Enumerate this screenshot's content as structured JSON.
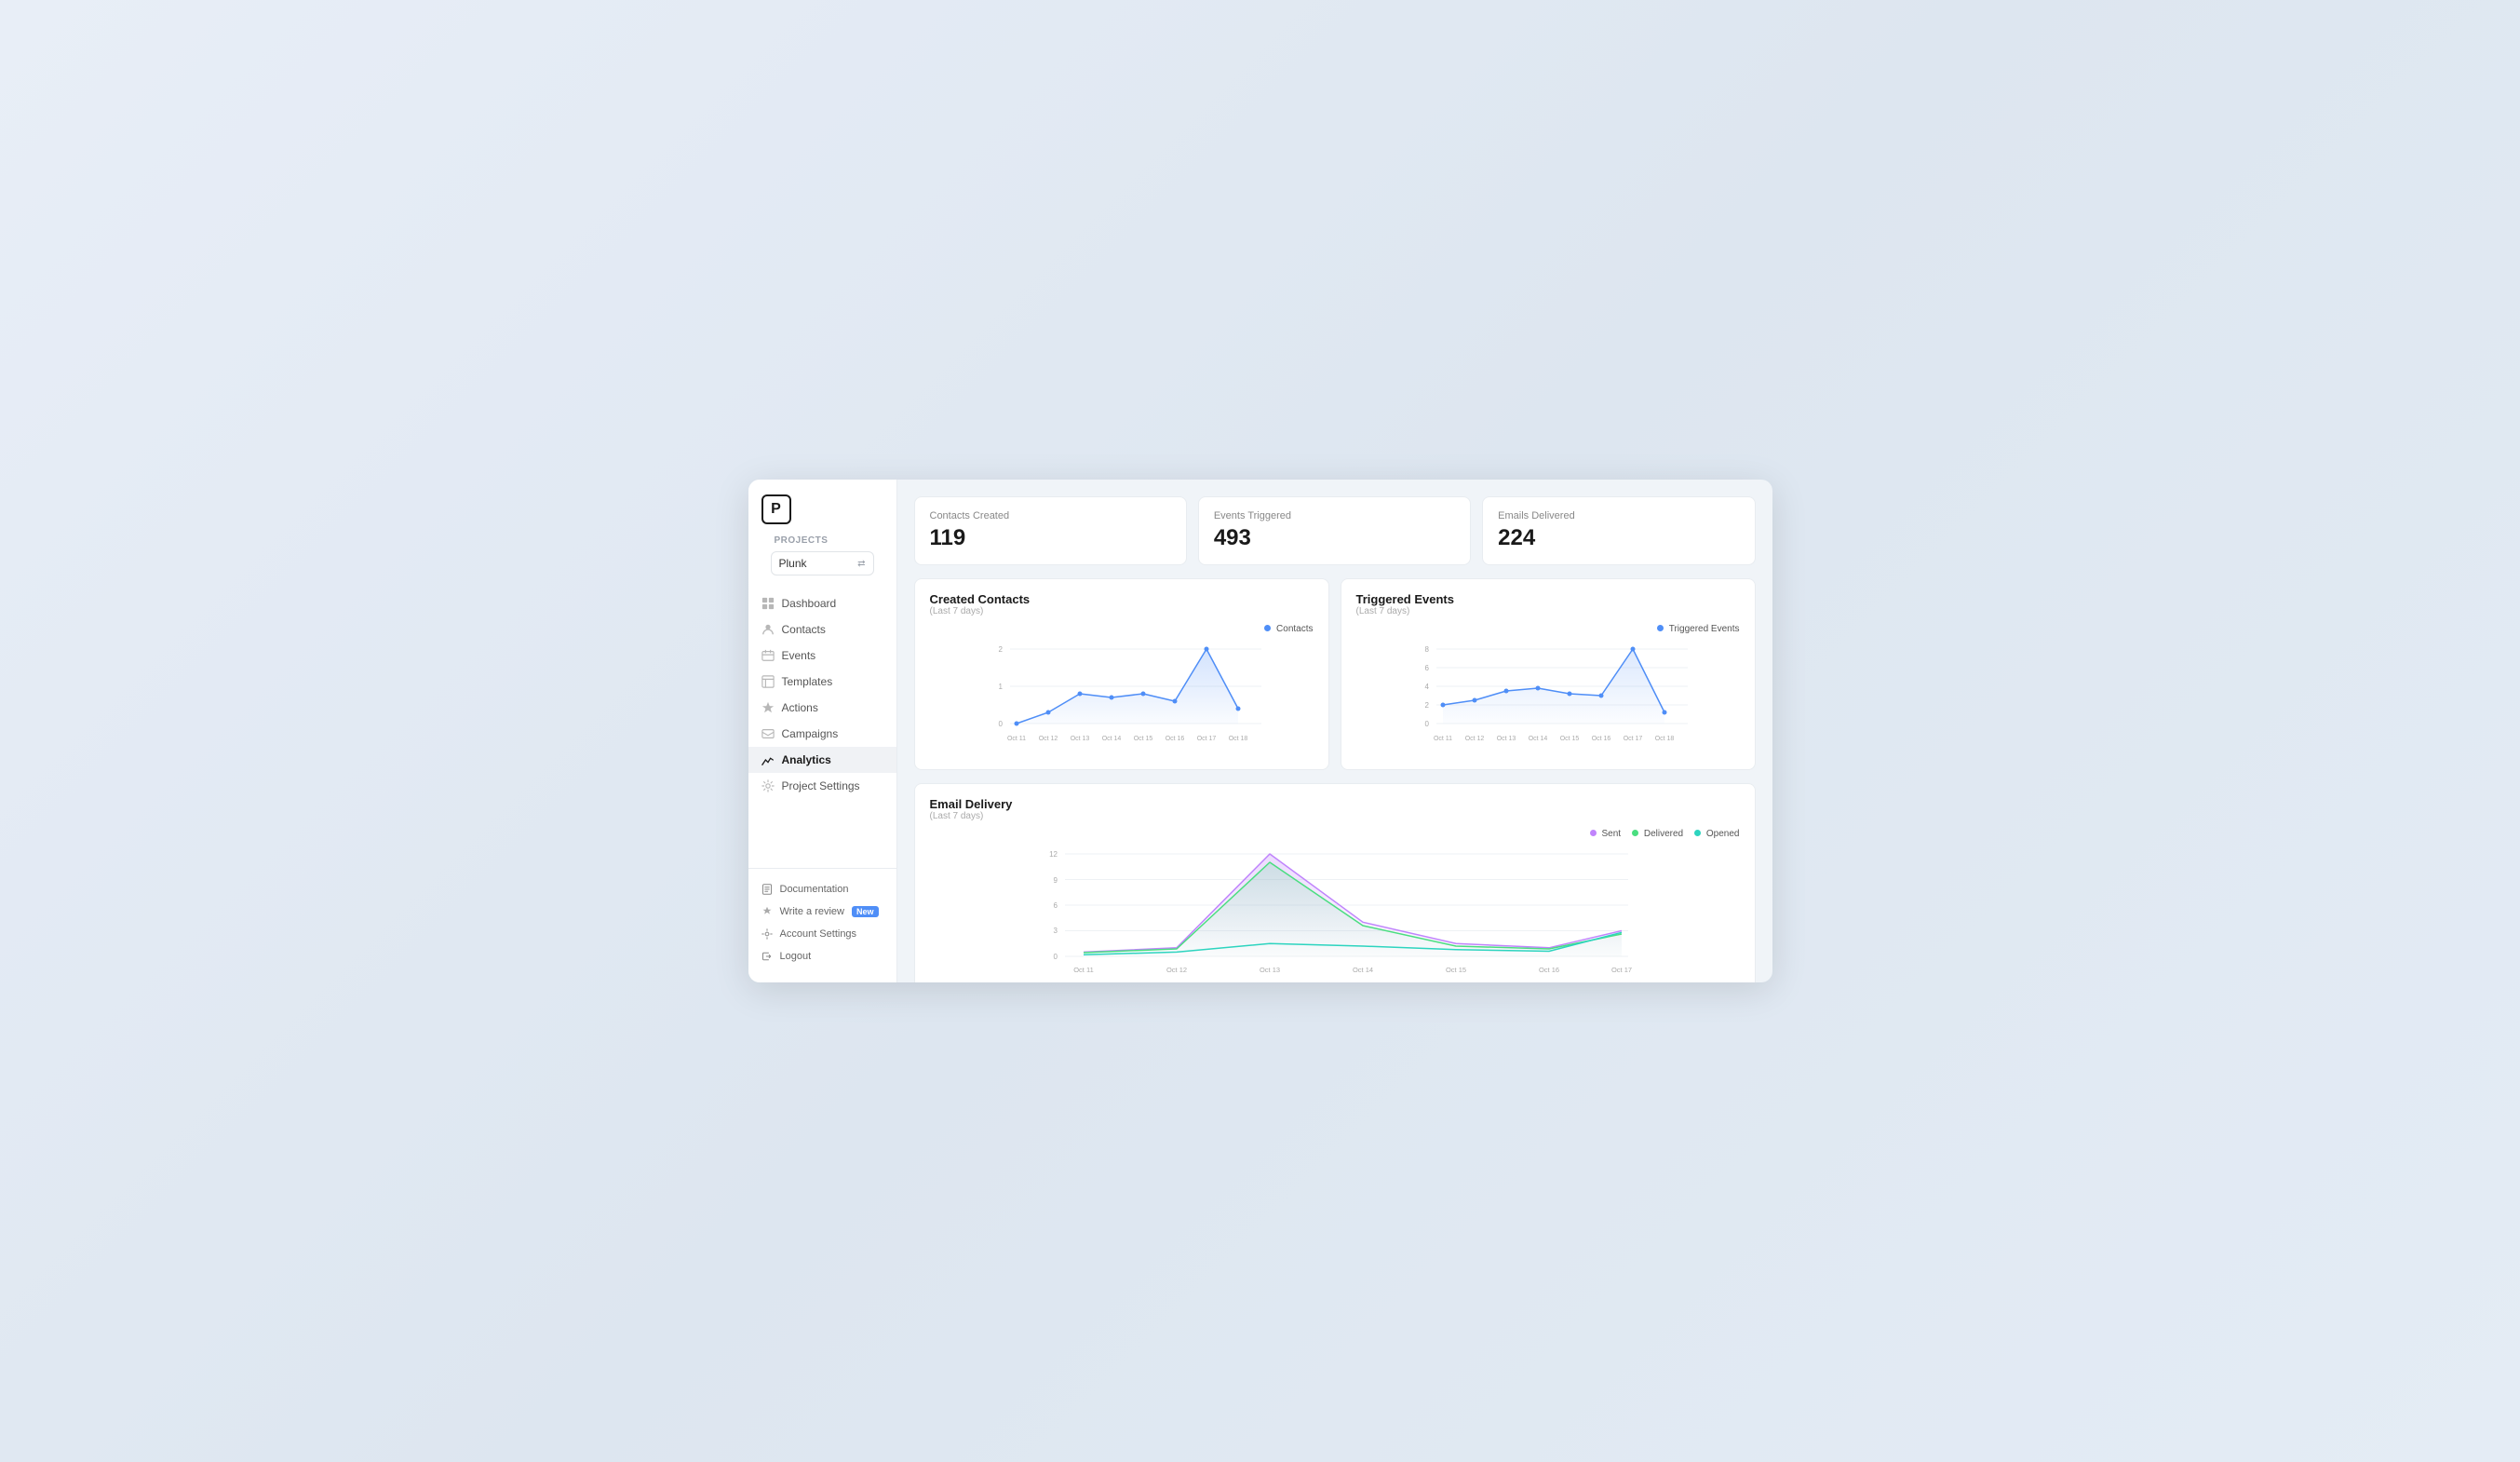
{
  "app": {
    "logo": "P",
    "projects_label": "Projects",
    "project_name": "Plunk"
  },
  "sidebar": {
    "nav_items": [
      {
        "id": "dashboard",
        "label": "Dashboard",
        "active": false
      },
      {
        "id": "contacts",
        "label": "Contacts",
        "active": false
      },
      {
        "id": "events",
        "label": "Events",
        "active": false
      },
      {
        "id": "templates",
        "label": "Templates",
        "active": false
      },
      {
        "id": "actions",
        "label": "Actions",
        "active": false
      },
      {
        "id": "campaigns",
        "label": "Campaigns",
        "active": false
      },
      {
        "id": "analytics",
        "label": "Analytics",
        "active": true
      },
      {
        "id": "project-settings",
        "label": "Project Settings",
        "active": false
      }
    ],
    "bottom_items": [
      {
        "id": "documentation",
        "label": "Documentation",
        "badge": null
      },
      {
        "id": "write-review",
        "label": "Write a review",
        "badge": "New"
      },
      {
        "id": "account-settings",
        "label": "Account Settings",
        "badge": null
      },
      {
        "id": "logout",
        "label": "Logout",
        "badge": null
      }
    ]
  },
  "stats": [
    {
      "label": "Contacts Created",
      "value": "119"
    },
    {
      "label": "Events Triggered",
      "value": "493"
    },
    {
      "label": "Emails Delivered",
      "value": "224"
    }
  ],
  "charts": {
    "created_contacts": {
      "title": "Created Contacts",
      "subtitle": "(Last 7 days)",
      "legend": "Contacts",
      "legend_color": "#4f8ef7",
      "x_labels": [
        "Oct 11",
        "Oct 12",
        "Oct 13",
        "Oct 14",
        "Oct 15",
        "Oct 16",
        "Oct 17",
        "Oct 18"
      ],
      "y_labels": [
        "0",
        "1",
        "2"
      ],
      "data_points": [
        0,
        0.3,
        0.8,
        0.7,
        0.8,
        0.6,
        2.0,
        0.4
      ]
    },
    "triggered_events": {
      "title": "Triggered Events",
      "subtitle": "(Last 7 days)",
      "legend": "Triggered Events",
      "legend_color": "#4f8ef7",
      "x_labels": [
        "Oct 11",
        "Oct 12",
        "Oct 13",
        "Oct 14",
        "Oct 15",
        "Oct 16",
        "Oct 17",
        "Oct 18"
      ],
      "y_labels": [
        "0",
        "2",
        "4",
        "6",
        "8"
      ],
      "data_points": [
        2,
        2.5,
        3.5,
        3.8,
        3.2,
        3.0,
        8.0,
        1.2
      ]
    },
    "email_delivery": {
      "title": "Email Delivery",
      "subtitle": "(Last 7 days)",
      "legend_sent": "Sent",
      "legend_sent_color": "#c084fc",
      "legend_delivered": "Delivered",
      "legend_delivered_color": "#4ade80",
      "legend_opened": "Opened",
      "legend_opened_color": "#2dd4bf",
      "x_labels": [
        "Oct 11",
        "Oct 12",
        "Oct 13",
        "Oct 14",
        "Oct 15",
        "Oct 16",
        "Oct 17"
      ],
      "y_labels": [
        "0",
        "3",
        "6",
        "9",
        "12"
      ],
      "sent_data": [
        0.5,
        1.0,
        12.0,
        4.0,
        1.5,
        1.0,
        3.0
      ],
      "delivered_data": [
        0.3,
        0.8,
        10.5,
        3.5,
        1.2,
        0.8,
        2.5
      ],
      "opened_data": [
        0.2,
        0.5,
        1.5,
        1.2,
        0.8,
        0.6,
        2.8
      ]
    }
  }
}
